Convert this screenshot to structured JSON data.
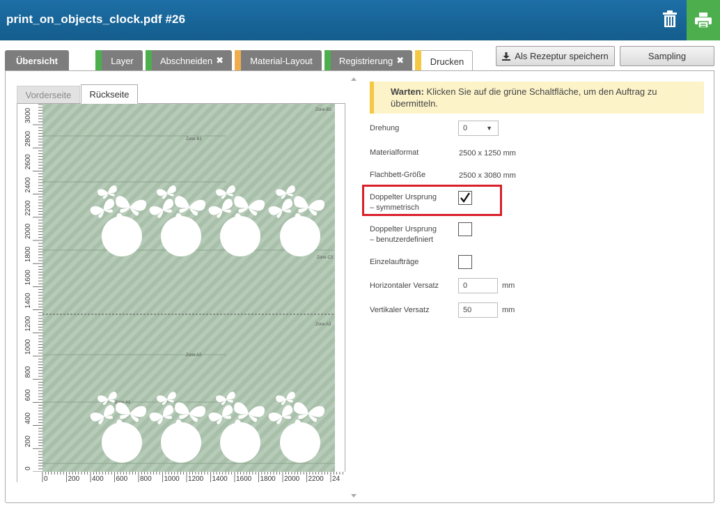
{
  "header": {
    "title": "print_on_objects_clock.pdf #26",
    "trash_icon": "trash-icon",
    "print_icon": "printer-icon",
    "print_color": "#4cae4c"
  },
  "tabs": [
    {
      "label": "Übersicht",
      "stripe": ""
    },
    {
      "label": "Layer",
      "stripe": "#4cae4c"
    },
    {
      "label": "Abschneiden",
      "stripe": "#4cae4c",
      "close": "✖"
    },
    {
      "label": "Material-Layout",
      "stripe": "#f0ad4e"
    },
    {
      "label": "Registrierung",
      "stripe": "#4cae4c",
      "close": "✖"
    },
    {
      "label": "Drucken",
      "stripe": "#f4c842"
    }
  ],
  "toolbar": {
    "save_recipe_label": "Als Rezeptur speichern",
    "sampling_label": "Sampling"
  },
  "preview": {
    "tab_front": "Vorderseite",
    "tab_back": "Rückseite",
    "zones": [
      "Zone B3",
      "Zone B2",
      "Zone C3",
      "Zone A3",
      "Zone A2",
      "Zone A1"
    ],
    "y_ruler": [
      "0",
      "200",
      "400",
      "600",
      "800",
      "1000",
      "1200",
      "1400",
      "1600",
      "1800",
      "2000",
      "2200",
      "2400",
      "2600",
      "2800",
      "3000"
    ],
    "x_ruler": [
      "0",
      "200",
      "400",
      "600",
      "800",
      "1000",
      "1200",
      "1400",
      "1600",
      "1800",
      "2000",
      "2200",
      "24"
    ]
  },
  "settings": {
    "warning_bold": "Warten:",
    "warning_text": " Klicken Sie auf die grüne Schaltfläche, um den Auftrag zu übermitteln.",
    "rotation_label": "Drehung",
    "rotation_value": "0",
    "material_format_label": "Materialformat",
    "material_format_value": "2500 x 1250 mm",
    "flatbed_label": "Flachbett-Größe",
    "flatbed_value": "2500 x 3080 mm",
    "double_origin_sym_label_1": "Doppelter Ursprung",
    "double_origin_sym_label_2": "– symmetrisch",
    "double_origin_sym_checked": true,
    "double_origin_custom_label_1": "Doppelter Ursprung",
    "double_origin_custom_label_2": "– benutzerdefiniert",
    "double_origin_custom_checked": false,
    "single_jobs_label": "Einzelaufträge",
    "single_jobs_checked": false,
    "h_offset_label": "Horizontaler Versatz",
    "h_offset_value": "0",
    "v_offset_label": "Vertikaler Versatz",
    "v_offset_value": "50",
    "unit_mm": "mm",
    "highlight_color": "#d81f2a"
  }
}
